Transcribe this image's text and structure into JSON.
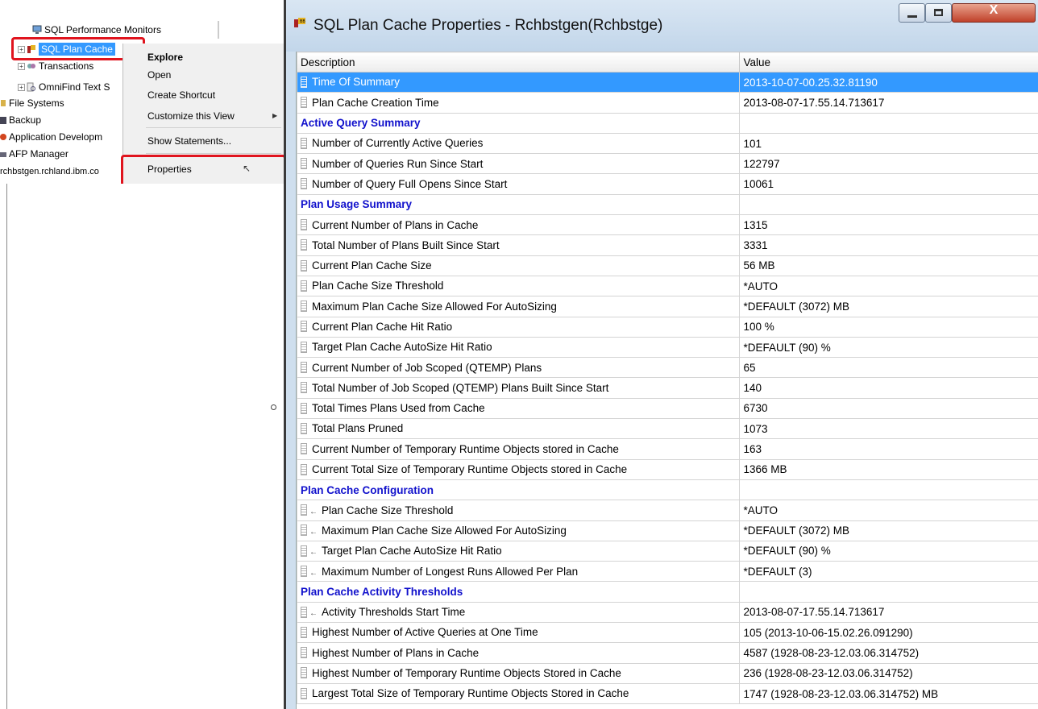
{
  "navigator": {
    "tree": [
      {
        "label": "SQL Performance Monitors"
      },
      {
        "label": "SQL Plan Cache"
      },
      {
        "label": "Transactions"
      },
      {
        "label": "OmniFind Text S"
      },
      {
        "label": "File Systems"
      },
      {
        "label": "Backup"
      },
      {
        "label": "Application Developm"
      },
      {
        "label": "AFP Manager"
      },
      {
        "label": "rchbstgen.rchland.ibm.co"
      }
    ]
  },
  "context_menu": {
    "items": [
      "Explore",
      "Open",
      "Create Shortcut",
      "Customize this View",
      "Show Statements...",
      "Properties"
    ]
  },
  "window": {
    "title": "SQL Plan Cache Properties - Rchbstgen(Rchbstge)",
    "close_glyph": "X"
  },
  "table": {
    "columns": [
      "Description",
      "Value"
    ],
    "rows": [
      {
        "type": "item",
        "icon": "bar",
        "description": "Time Of Summary",
        "value": "2013-10-07-00.25.32.81190",
        "selected": true
      },
      {
        "type": "item",
        "icon": "bar",
        "description": "Plan Cache Creation Time",
        "value": "2013-08-07-17.55.14.713617"
      },
      {
        "type": "section",
        "description": "Active Query Summary",
        "value": ""
      },
      {
        "type": "item",
        "icon": "bar",
        "description": "Number of Currently Active Queries",
        "value": "101"
      },
      {
        "type": "item",
        "icon": "bar",
        "description": "Number of Queries Run Since Start",
        "value": "122797"
      },
      {
        "type": "item",
        "icon": "bar",
        "description": "Number of Query Full Opens Since Start",
        "value": "10061"
      },
      {
        "type": "section",
        "description": "Plan Usage Summary",
        "value": ""
      },
      {
        "type": "item",
        "icon": "bar",
        "description": "Current Number of Plans in Cache",
        "value": "1315"
      },
      {
        "type": "item",
        "icon": "bar",
        "description": "Total Number of Plans Built Since Start",
        "value": "3331"
      },
      {
        "type": "item",
        "icon": "bar",
        "description": "Current Plan Cache Size",
        "value": "56 MB"
      },
      {
        "type": "item",
        "icon": "bar",
        "description": "Plan Cache Size Threshold",
        "value": "*AUTO"
      },
      {
        "type": "item",
        "icon": "bar",
        "description": "Maximum Plan Cache Size Allowed For AutoSizing",
        "value": "*DEFAULT (3072) MB"
      },
      {
        "type": "item",
        "icon": "bar",
        "description": "Current Plan Cache Hit Ratio",
        "value": "100 %"
      },
      {
        "type": "item",
        "icon": "bar",
        "description": "Target Plan Cache AutoSize Hit Ratio",
        "value": "*DEFAULT (90) %"
      },
      {
        "type": "item",
        "icon": "bar",
        "description": "Current Number of Job Scoped (QTEMP) Plans",
        "value": "65"
      },
      {
        "type": "item",
        "icon": "bar",
        "description": "Total Number of Job Scoped (QTEMP) Plans Built Since Start",
        "value": "140"
      },
      {
        "type": "item",
        "icon": "bar",
        "description": "Total Times Plans Used from Cache",
        "value": "6730"
      },
      {
        "type": "item",
        "icon": "bar",
        "description": "Total Plans Pruned",
        "value": "1073"
      },
      {
        "type": "item",
        "icon": "bar",
        "description": "Current Number of Temporary Runtime Objects stored in Cache",
        "value": "163"
      },
      {
        "type": "item",
        "icon": "bar",
        "description": "Current Total Size of Temporary Runtime Objects stored in Cache",
        "value": "1366 MB"
      },
      {
        "type": "section",
        "description": "Plan Cache Configuration",
        "value": ""
      },
      {
        "type": "item",
        "icon": "bar-arrow",
        "description": "Plan Cache Size Threshold",
        "value": "*AUTO"
      },
      {
        "type": "item",
        "icon": "bar-arrow",
        "description": "Maximum Plan Cache Size Allowed For AutoSizing",
        "value": "*DEFAULT (3072) MB"
      },
      {
        "type": "item",
        "icon": "bar-arrow",
        "description": "Target Plan Cache AutoSize Hit Ratio",
        "value": "*DEFAULT (90) %"
      },
      {
        "type": "item",
        "icon": "bar-arrow",
        "description": "Maximum Number of Longest Runs Allowed Per Plan",
        "value": "*DEFAULT (3)"
      },
      {
        "type": "section",
        "description": "Plan Cache Activity Thresholds",
        "value": ""
      },
      {
        "type": "item",
        "icon": "bar-arrow",
        "description": "Activity Thresholds Start Time",
        "value": "2013-08-07-17.55.14.713617"
      },
      {
        "type": "item",
        "icon": "bar",
        "description": "Highest Number of Active Queries at One Time",
        "value": "105  (2013-10-06-15.02.26.091290)"
      },
      {
        "type": "item",
        "icon": "bar",
        "description": "Highest Number of Plans in Cache",
        "value": "4587  (1928-08-23-12.03.06.314752)"
      },
      {
        "type": "item",
        "icon": "bar",
        "description": "Highest Number of Temporary Runtime Objects Stored in Cache",
        "value": "236  (1928-08-23-12.03.06.314752)"
      },
      {
        "type": "item",
        "icon": "bar",
        "description": "Largest Total Size of Temporary Runtime Objects Stored in Cache",
        "value": "1747  (1928-08-23-12.03.06.314752) MB"
      }
    ]
  },
  "colors": {
    "selection": "#3399ff",
    "section_text": "#1111cc",
    "highlight_box": "#e0141e"
  }
}
